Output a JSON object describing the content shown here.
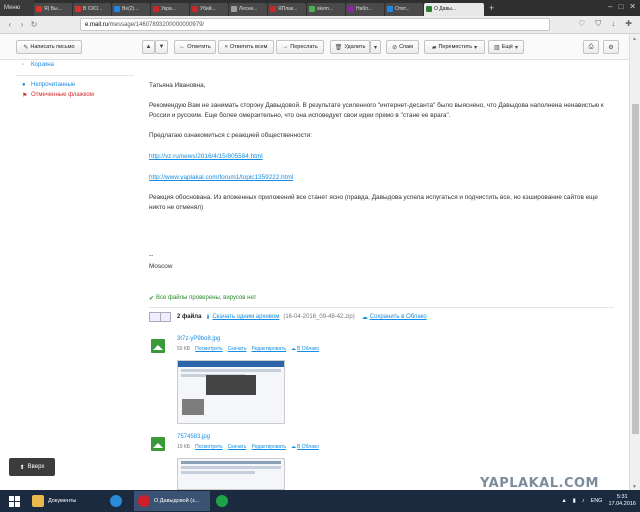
{
  "browser": {
    "menu_label": "Меню",
    "tabs": [
      {
        "title": "Я) Вы...",
        "color": "#d9322a"
      },
      {
        "title": "В СКО...",
        "color": "#d9322a"
      },
      {
        "title": "Ве(2)...",
        "color": "#1e88e5"
      },
      {
        "title": "Укра...",
        "color": "#c62828"
      },
      {
        "title": "Убий...",
        "color": "#c62828"
      },
      {
        "title": "Лесни...",
        "color": "#9e9e9e"
      },
      {
        "title": "ЯПлак...",
        "color": "#c62828"
      },
      {
        "title": "skem...",
        "color": "#4caf50"
      },
      {
        "title": "Набл...",
        "color": "#8e24aa"
      },
      {
        "title": "Отвт...",
        "color": "#1e88e5"
      },
      {
        "title": "О Давы...",
        "color": "#2e7d32",
        "active": true
      }
    ],
    "url_domain": "e.mail.ru",
    "url_path": "/message/14607893200000000979/"
  },
  "toolbar": {
    "compose": "Написать письмо",
    "reply": "Ответить",
    "reply_all": "Ответить всем",
    "forward": "Переслать",
    "delete": "Удалить",
    "spam": "Спам",
    "move": "Переместить",
    "more": "Ещё"
  },
  "sidebar": {
    "trash": "Корзина",
    "unread": "Непрочитанные",
    "flagged": "Отмеченные флажком"
  },
  "message": {
    "greeting": "Татьяна Ивановна,",
    "para1": "Рекомендую Вам не занимать сторону Давыдовой. В результате усиленного \"интернет-десанта\" было выяснено, что Давыдова наполнена ненавистью к России и русским. Еще более омерзительно, что она исповедует свои идеи прямо в \"стане ее врага\".",
    "para2": "Предлагаю ознакомиться с реакцией общественности:",
    "link1": "http://vz.ru/news/2016/4/15/805584.html",
    "link2": "http://www.yaplakal.com/forum1/topic1359222.html",
    "para3": "Реакция обоснована. Из вложенных приложений все станет ясно (правда, Давыдова успела испугаться и подчистить все, но кэширование сайтов еще никто не отменял)",
    "sig_dash": "--",
    "sig_city": "Moscow"
  },
  "attachments": {
    "verified": "Все файлы проверены, вирусов нет",
    "count": "2 файла",
    "download_all": "Скачать одним архивом",
    "archive_info": "(16-04-2016_09-48-42.zip)",
    "save_cloud": "Сохранить в Облако",
    "files": [
      {
        "name": "3t7z-yP9bo8.jpg",
        "size": "50 КБ",
        "view": "Посмотреть",
        "download": "Скачать",
        "edit": "Редактировать",
        "cloud": "В Облако"
      },
      {
        "name": "7574583.jpg",
        "size": "19 КБ",
        "view": "Посмотреть",
        "download": "Скачать",
        "edit": "Редактировать",
        "cloud": "В Облако"
      }
    ]
  },
  "up_button": "Вверх",
  "watermark": "YAPLAKAL.COM",
  "taskbar": {
    "documents": "Документы",
    "opera_window": "О Давыдовой (з...",
    "lang": "ENG",
    "time": "5:31",
    "date": "17.04.2016"
  }
}
